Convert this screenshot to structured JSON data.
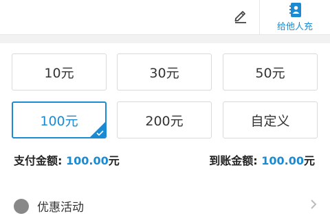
{
  "header": {
    "edit_icon": "edit-icon",
    "recharge_others": {
      "label": "给他人充",
      "icon": "contact-card-icon"
    }
  },
  "amounts": [
    {
      "label": "10元",
      "selected": false
    },
    {
      "label": "30元",
      "selected": false
    },
    {
      "label": "50元",
      "selected": false
    },
    {
      "label": "100元",
      "selected": true
    },
    {
      "label": "200元",
      "selected": false
    },
    {
      "label": "自定义",
      "selected": false
    }
  ],
  "summary": {
    "pay_label": "支付金额: ",
    "pay_value": "100.00",
    "pay_unit": "元",
    "receive_label": "到账金额: ",
    "receive_value": "100.00",
    "receive_unit": "元"
  },
  "promo": {
    "label": "优惠活动",
    "icon": "promo-icon",
    "arrow": "chevron-right-icon"
  },
  "colors": {
    "accent": "#1a8ad2",
    "border": "#d9d9d9",
    "separator": "#f2f2f2",
    "text": "#333333"
  }
}
